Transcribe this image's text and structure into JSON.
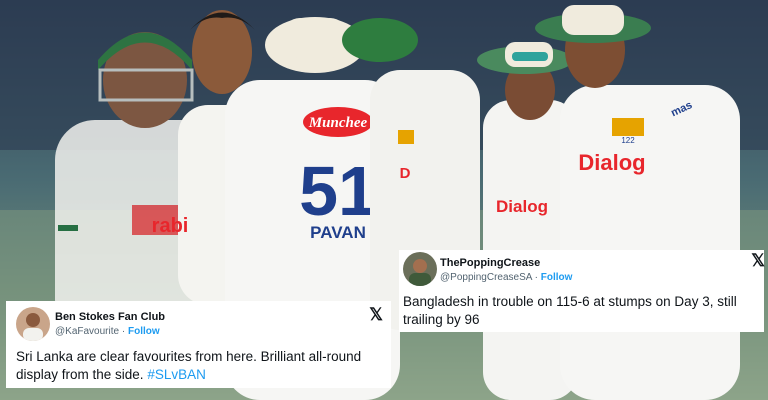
{
  "photo": {
    "alt": "",
    "jersey_sponsor": "Munchee",
    "jersey_number": "51",
    "jersey_name": "PAVAN",
    "shirt_brand": "Dialog",
    "shirt_brand_2": "rabi",
    "sleeve_brand": "mas",
    "collar_number": "122"
  },
  "tweet_left": {
    "display_name": "Ben Stokes Fan Club",
    "handle": "@KaFavourite",
    "separator": "·",
    "follow_label": "Follow",
    "text": "Sri Lanka are clear favourites from here. Brilliant all-round display from the side. ",
    "hashtag": "#SLvBAN",
    "x_icon_glyph": "𝕏"
  },
  "tweet_right": {
    "display_name": "ThePoppingCrease",
    "handle": "@PoppingCreaseSA",
    "separator": "·",
    "follow_label": "Follow",
    "text": "Bangladesh in trouble on 115-6 at stumps on Day 3, still trailing by 96",
    "x_icon_glyph": "𝕏"
  },
  "colors": {
    "link_blue": "#1d9bf0",
    "handle_gray": "#536471",
    "jersey_red": "#e8262c",
    "bangladesh_green": "#1a6b3a"
  }
}
